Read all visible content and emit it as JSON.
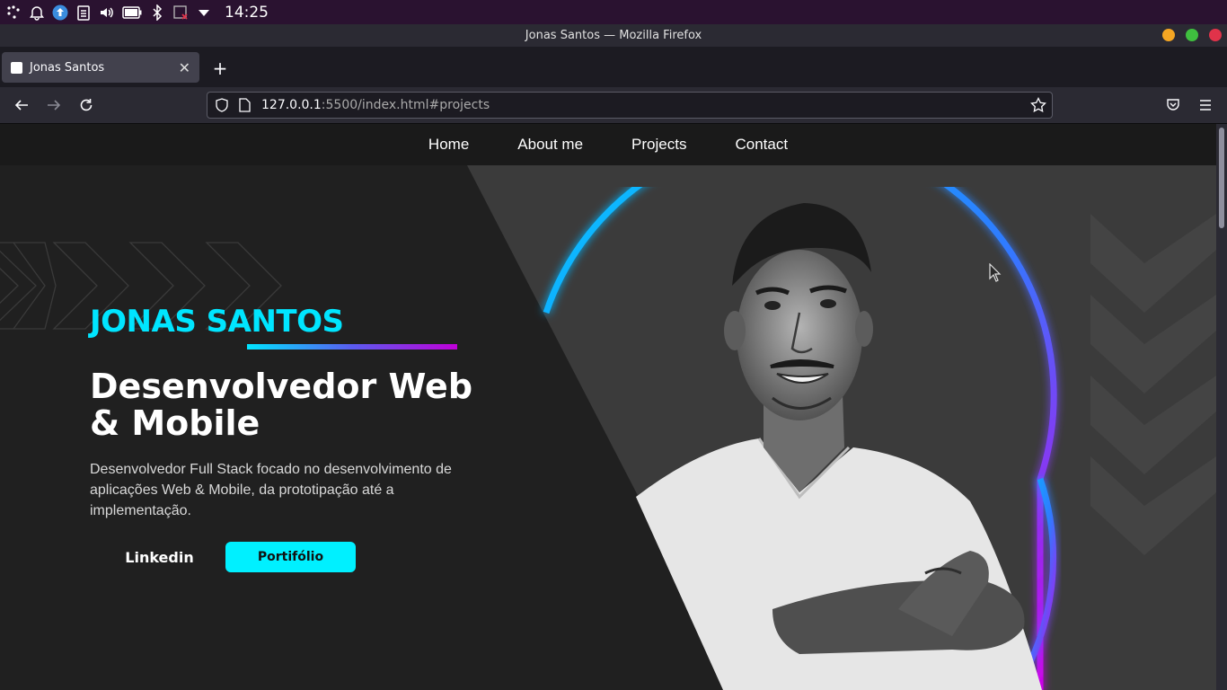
{
  "system": {
    "time": "14:25",
    "icons": [
      "launcher-icon",
      "alarm-icon",
      "update-icon",
      "clipboard-icon",
      "volume-icon",
      "battery-icon",
      "bluetooth-icon",
      "network-off-icon",
      "dropdown-icon"
    ]
  },
  "window": {
    "title": "Jonas Santos — Mozilla Firefox",
    "buttons": {
      "minimize_color": "#f5a623",
      "maximize_color": "#3fbf3f",
      "close_color": "#e0334a"
    }
  },
  "browser": {
    "tab_title": "Jonas Santos",
    "url_host": "127.0.0.1",
    "url_rest": ":5500/index.html#projects"
  },
  "page": {
    "nav": [
      "Home",
      "About me",
      "Projects",
      "Contact"
    ],
    "name": "JONAS SANTOS",
    "title": "Desenvolvedor Web & Mobile",
    "description": "Desenvolvedor Full Stack focado no desenvolvimento de aplicações Web & Mobile, da prototipação até a implementação.",
    "linkedin_label": "Linkedin",
    "portfolio_label": "Portifólio",
    "accent": "#00e5ff",
    "gradient": [
      "#00e5ff",
      "#5a5cf0",
      "#c000d8"
    ]
  }
}
